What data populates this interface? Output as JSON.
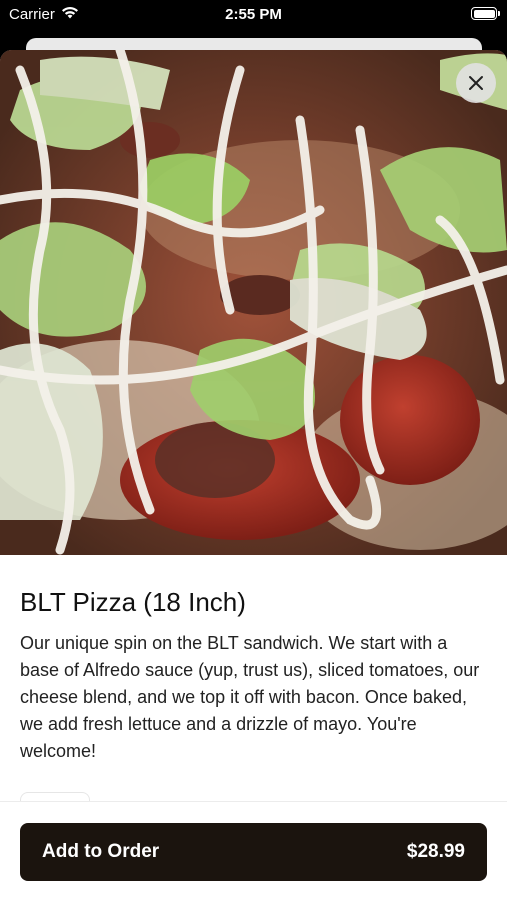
{
  "status_bar": {
    "carrier": "Carrier",
    "time": "2:55 PM"
  },
  "item": {
    "title": "BLT Pizza (18 Inch)",
    "description": "Our unique spin on the BLT sandwich. We start with a base of Alfredo sauce (yup, trust us), sliced tomatoes, our cheese blend, and we top it off with bacon. Once baked, we add fresh lettuce and a drizzle of mayo. You're welcome!",
    "image": "blt-pizza-photo"
  },
  "footer": {
    "add_label": "Add to Order",
    "price": "$28.99"
  },
  "colors": {
    "button_bg": "#1b140e",
    "sheet_bg": "#ffffff",
    "status_bg": "#000000"
  },
  "icons": {
    "wifi": "wifi-icon",
    "battery": "battery-icon",
    "close": "close-icon"
  }
}
